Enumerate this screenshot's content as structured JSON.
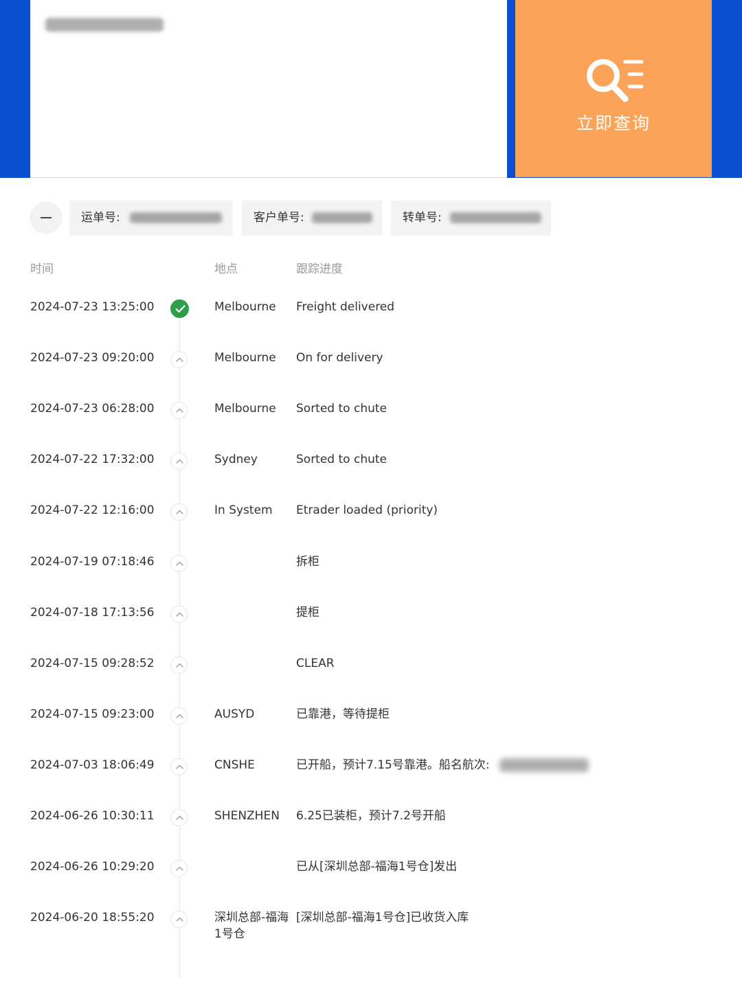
{
  "search": {
    "input_value": "",
    "button_label": "立即查询",
    "button_icon": "search-list-icon"
  },
  "tags": {
    "waybill_label": "运单号:",
    "customer_label": "客户单号:",
    "transfer_label": "转单号:"
  },
  "table": {
    "headers": {
      "time": "时间",
      "location": "地点",
      "progress": "跟踪进度"
    },
    "rows": [
      {
        "time": "2024-07-23 13:25:00",
        "location": "Melbourne",
        "progress": "Freight delivered",
        "status": "delivered"
      },
      {
        "time": "2024-07-23 09:20:00",
        "location": "Melbourne",
        "progress": "On for delivery",
        "status": "step"
      },
      {
        "time": "2024-07-23 06:28:00",
        "location": "Melbourne",
        "progress": "Sorted to chute",
        "status": "step"
      },
      {
        "time": "2024-07-22 17:32:00",
        "location": "Sydney",
        "progress": "Sorted to chute",
        "status": "step"
      },
      {
        "time": "2024-07-22 12:16:00",
        "location": "In System",
        "progress": "Etrader loaded (priority)",
        "status": "step"
      },
      {
        "time": "2024-07-19 07:18:46",
        "location": "",
        "progress": "拆柜",
        "status": "step"
      },
      {
        "time": "2024-07-18 17:13:56",
        "location": "",
        "progress": "提柜",
        "status": "step"
      },
      {
        "time": "2024-07-15 09:28:52",
        "location": "",
        "progress": "CLEAR",
        "status": "step"
      },
      {
        "time": "2024-07-15 09:23:00",
        "location": "AUSYD",
        "progress": "已靠港，等待提柜",
        "status": "step"
      },
      {
        "time": "2024-07-03 18:06:49",
        "location": "CNSHE",
        "progress": "已开船，预计7.15号靠港。船名航次:",
        "status": "step"
      },
      {
        "time": "2024-06-26 10:30:11",
        "location": "SHENZHEN",
        "progress": "6.25已装柜，预计7.2号开船",
        "status": "step"
      },
      {
        "time": "2024-06-26 10:29:20",
        "location": "",
        "progress": "已从[深圳总部-福海1号仓]发出",
        "status": "step"
      },
      {
        "time": "2024-06-20 18:55:20",
        "location": "深圳总部-福海1号仓",
        "progress": "[深圳总部-福海1号仓]已收货入库",
        "status": "step"
      }
    ]
  },
  "colors": {
    "banner_blue": "#0b4fd1",
    "button_orange": "#fca35a",
    "delivered_green": "#2f9e4b"
  }
}
